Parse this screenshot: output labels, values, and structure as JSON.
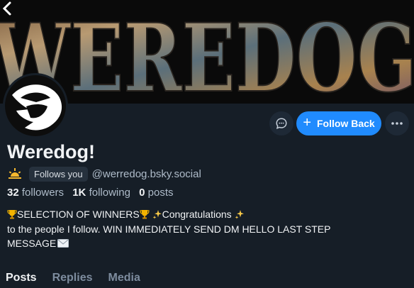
{
  "banner": {
    "text": "WEREDOG"
  },
  "profile": {
    "display_name": "Weredog!",
    "follows_you_badge": "Follows you",
    "handle": "@werredog.bsky.social",
    "followers_count": "32",
    "followers_label": "followers",
    "following_count": "1K",
    "following_label": "following",
    "posts_count": "0",
    "posts_label": "posts"
  },
  "bio": {
    "line1_a": "SELECTION OF WINNERS",
    "line1_b": "Congratulations",
    "line2": "to the people I follow. WIN IMMEDIATELY SEND DM HELLO LAST STEP",
    "line3": "MESSAGE"
  },
  "actions": {
    "follow_back_label": "Follow Back",
    "follow_plus": "+"
  },
  "tabs": [
    {
      "label": "Posts",
      "active": true
    },
    {
      "label": "Replies",
      "active": false
    },
    {
      "label": "Media",
      "active": false
    }
  ],
  "colors": {
    "background": "#161e27",
    "accent": "#208bfe",
    "muted_text": "#aebbc9"
  }
}
